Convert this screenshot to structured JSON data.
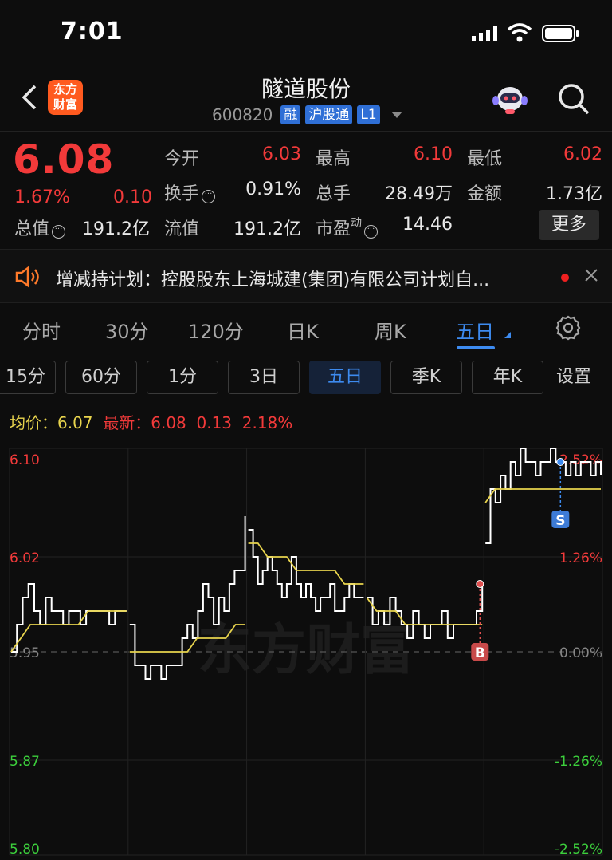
{
  "status": {
    "time": "7:01"
  },
  "header": {
    "title": "隧道股份",
    "code": "600820",
    "logo_text": "东方财富",
    "tags": [
      "融",
      "沪股通",
      "L1"
    ]
  },
  "quote": {
    "price": "6.08",
    "change_pct": "1.67%",
    "change": "0.10",
    "open_label": "今开",
    "open": "6.03",
    "high_label": "最高",
    "high": "6.10",
    "low_label": "最低",
    "low": "6.02",
    "turnover_label": "换手",
    "turnover": "0.91%",
    "volume_label": "总手",
    "volume": "28.49万",
    "amount_label": "金额",
    "amount": "1.73亿",
    "mktcap_label": "总值",
    "mktcap": "191.2亿",
    "float_label": "流值",
    "float": "191.2亿",
    "pe_label": "市盈",
    "pe_sup": "动",
    "pe": "14.46",
    "more_label": "更多"
  },
  "notice": {
    "text": "增减持计划：控股股东上海城建(集团)有限公司计划自..."
  },
  "period_tabs": [
    "分时",
    "30分",
    "120分",
    "日K",
    "周K",
    "五日"
  ],
  "active_period": "五日",
  "sub_tabs": [
    "15分",
    "60分",
    "1分",
    "3日",
    "五日",
    "季K",
    "年K"
  ],
  "sub_settings_label": "设置",
  "legend": {
    "avg_label": "均价：",
    "avg": "6.07",
    "latest_label": "最新：",
    "latest": "6.08",
    "latest_chg": "0.13",
    "latest_pct": "2.18%"
  },
  "chart_data": {
    "type": "line",
    "title": "",
    "xlabel": "",
    "ylabel": "",
    "y_left_ticks": [
      "6.10",
      "6.02",
      "5.95",
      "5.87",
      "5.80"
    ],
    "y_right_ticks": [
      "2.52%",
      "1.26%",
      "0.00%",
      "-1.26%",
      "-2.52%"
    ],
    "ylim": [
      5.8,
      6.1
    ],
    "prev_close": 5.95,
    "days": 5,
    "grid": true,
    "watermark": "东方财富",
    "markers": [
      {
        "label": "B",
        "day": 4,
        "pos": 0.98,
        "price": 6.0
      },
      {
        "label": "S",
        "day": 5,
        "pos": 0.65,
        "price": 6.09
      }
    ],
    "series": [
      {
        "name": "价格",
        "color": "#ffffff",
        "values": [
          [
            5.95,
            5.97,
            5.99,
            6.0,
            5.98,
            5.97,
            5.99,
            5.98,
            5.98,
            5.97,
            5.98,
            5.98,
            5.97,
            5.98,
            5.98,
            5.98,
            5.98,
            5.97,
            5.98,
            5.98,
            5.98
          ],
          [
            5.97,
            5.94,
            5.94,
            5.93,
            5.94,
            5.94,
            5.93,
            5.94,
            5.94,
            5.94,
            5.96,
            5.97,
            5.96,
            5.98,
            6.0,
            5.99,
            5.97,
            5.99,
            5.98,
            6.0,
            6.01,
            6.01,
            6.05
          ],
          [
            6.04,
            6.02,
            6.0,
            6.01,
            6.02,
            6.01,
            6.0,
            5.99,
            6.0,
            6.02,
            6.0,
            5.99,
            6.0,
            5.99,
            5.98,
            5.99,
            5.99,
            6.0,
            5.98,
            5.98,
            5.99,
            6.0,
            5.99,
            5.99,
            5.99
          ],
          [
            5.99,
            5.97,
            5.98,
            5.97,
            5.99,
            5.98,
            5.97,
            5.96,
            5.98,
            5.97,
            5.96,
            5.97,
            5.97,
            5.98,
            5.96,
            5.97,
            5.97,
            5.97,
            5.97,
            5.98,
            6.0
          ],
          [
            6.03,
            6.07,
            6.06,
            6.08,
            6.07,
            6.09,
            6.08,
            6.1,
            6.09,
            6.09,
            6.08,
            6.09,
            6.09,
            6.1,
            6.09,
            6.09,
            6.08,
            6.09,
            6.08,
            6.09,
            6.09,
            6.08,
            6.09,
            6.08
          ]
        ]
      },
      {
        "name": "均价",
        "color": "#e8d44d",
        "values": [
          [
            5.95,
            5.96,
            5.97,
            5.97,
            5.97,
            5.97,
            5.97,
            5.97,
            5.98,
            5.98,
            5.98,
            5.98,
            5.98
          ],
          [
            5.95,
            5.95,
            5.95,
            5.95,
            5.95,
            5.95,
            5.95,
            5.96,
            5.96,
            5.96,
            5.96,
            5.97,
            5.97
          ],
          [
            6.03,
            6.03,
            6.02,
            6.02,
            6.02,
            6.01,
            6.01,
            6.01,
            6.01,
            6.01,
            6.0,
            6.0,
            6.0
          ],
          [
            5.99,
            5.98,
            5.98,
            5.98,
            5.97,
            5.97,
            5.97,
            5.97,
            5.97,
            5.97,
            5.97,
            5.97,
            5.97
          ],
          [
            6.06,
            6.07,
            6.07,
            6.07,
            6.07,
            6.07,
            6.07,
            6.07,
            6.07,
            6.07,
            6.07,
            6.07,
            6.07
          ]
        ]
      }
    ]
  }
}
